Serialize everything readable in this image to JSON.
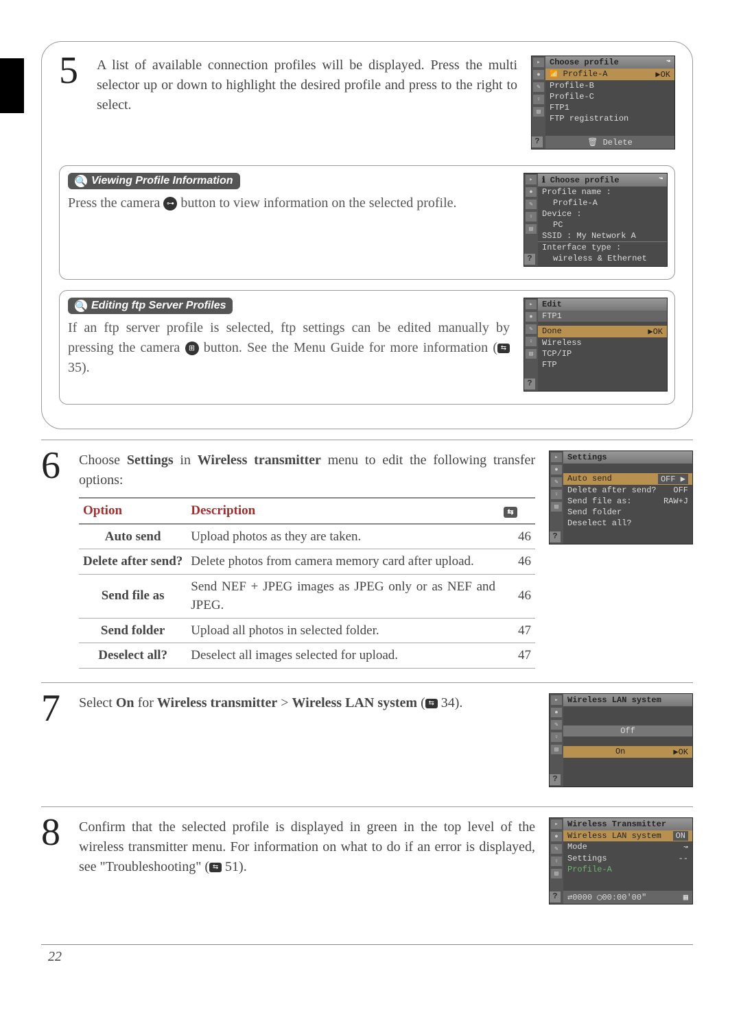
{
  "page_number": "22",
  "step5": {
    "text": "A list of available connection profiles will be displayed. Press the multi selector up or down to highlight the desired profile and press to the right to select."
  },
  "screen1": {
    "title": "Choose profile",
    "items": [
      "Profile-A",
      "Profile-B",
      "Profile-C",
      "FTP1",
      "FTP registration"
    ],
    "ok": "▶OK",
    "footer": "Delete"
  },
  "note_view": {
    "heading": "Viewing Profile Information",
    "body_a": "Press the camera ",
    "body_b": " button to view information on the selected profile."
  },
  "screen2": {
    "title": "Choose profile",
    "rows": [
      "Profile name :",
      "Profile-A",
      "Device :",
      "PC",
      "SSID : My Network A",
      "Interface type :",
      "wireless & Ethernet"
    ]
  },
  "note_edit": {
    "heading": "Editing ftp Server Profiles",
    "body_a": "If an ftp server profile is selected, ftp settings can be edited manually by pressing the camera ",
    "body_b": " button. See the Menu Guide for more information (",
    "body_c": " 35)."
  },
  "screen3": {
    "title": "Edit",
    "sub": "FTP1",
    "items": [
      "Done",
      "Wireless",
      "TCP/IP",
      "FTP"
    ],
    "ok": "▶OK"
  },
  "step6": {
    "text_a": "Choose ",
    "b1": "Settings",
    "text_b": " in ",
    "b2": "Wireless transmitter",
    "text_c": " menu to edit the following transfer options:"
  },
  "screen4": {
    "title": "Settings",
    "rows": [
      {
        "l": "Auto send",
        "r": "OFF ▶"
      },
      {
        "l": "Delete after send?",
        "r": "OFF"
      },
      {
        "l": "Send file as:",
        "r": "RAW+J"
      },
      {
        "l": "Send folder",
        "r": ""
      },
      {
        "l": "Deselect all?",
        "r": ""
      }
    ]
  },
  "table": {
    "h1": "Option",
    "h2": "Description",
    "rows": [
      {
        "option": "Auto send",
        "desc": "Upload photos as they are taken.",
        "pg": "46"
      },
      {
        "option": "Delete after send?",
        "desc": "Delete photos from camera memory card after upload.",
        "pg": "46"
      },
      {
        "option": "Send file as",
        "desc": "Send NEF + JPEG images as JPEG only or as NEF and JPEG.",
        "pg": "46"
      },
      {
        "option": "Send folder",
        "desc": "Upload all photos in selected folder.",
        "pg": "47"
      },
      {
        "option": "Deselect all?",
        "desc": "Deselect all images selected for upload.",
        "pg": "47"
      }
    ]
  },
  "step7": {
    "a": "Select ",
    "b1": "On",
    "b": " for ",
    "b2": "Wireless transmitter",
    "c": " > ",
    "b3": "Wireless LAN system",
    "d": " (",
    "e": " 34)."
  },
  "screen5": {
    "title": "Wireless LAN system",
    "off": "Off",
    "on": "On",
    "ok": "▶OK"
  },
  "step8": {
    "a": "Confirm that the selected profile is displayed in green in the top level of the wireless transmitter menu. For information on what to do if an error is displayed, see \"Troubleshooting\" (",
    "b": " 51)."
  },
  "screen6": {
    "title": "Wireless Transmitter",
    "rows": [
      {
        "l": "Wireless LAN system",
        "r": "ON"
      },
      {
        "l": "Mode",
        "r": "↝"
      },
      {
        "l": "Settings",
        "r": "--"
      }
    ],
    "profile": "Profile-A",
    "footer": "⇄0000 ◯00:00'00\""
  }
}
